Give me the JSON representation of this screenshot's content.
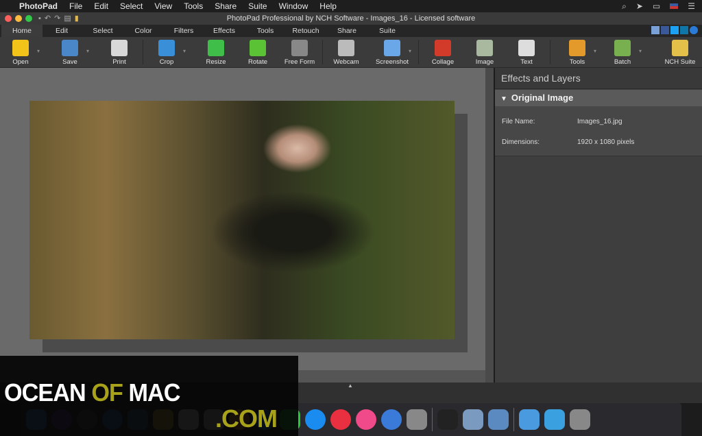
{
  "menubar": {
    "app": "PhotoPad",
    "items": [
      "File",
      "Edit",
      "Select",
      "View",
      "Tools",
      "Share",
      "Suite",
      "Window",
      "Help"
    ]
  },
  "window": {
    "title": "PhotoPad Professional by NCH Software - Images_16 - Licensed software"
  },
  "tabs": [
    "Home",
    "Edit",
    "Select",
    "Color",
    "Filters",
    "Effects",
    "Tools",
    "Retouch",
    "Share",
    "Suite"
  ],
  "active_tab": "Home",
  "toolbar": [
    {
      "label": "Open",
      "icon": "folder-icon",
      "color": "#f2c318",
      "dropdown": true
    },
    {
      "label": "Save",
      "icon": "floppy-icon",
      "color": "#4a87c9",
      "dropdown": true
    },
    {
      "label": "Print",
      "icon": "printer-icon",
      "color": "#d8d8d8"
    },
    {
      "label": "Crop",
      "icon": "crop-icon",
      "color": "#3a8fd9",
      "dropdown": true
    },
    {
      "label": "Resize",
      "icon": "resize-icon",
      "color": "#3fbf4a"
    },
    {
      "label": "Rotate",
      "icon": "rotate-icon",
      "color": "#5bc236"
    },
    {
      "label": "Free Form",
      "icon": "freeform-icon",
      "color": "#888888"
    },
    {
      "label": "Webcam",
      "icon": "webcam-icon",
      "color": "#bbbbbb"
    },
    {
      "label": "Screenshot",
      "icon": "screenshot-icon",
      "color": "#6aa7e8",
      "dropdown": true
    },
    {
      "label": "Collage",
      "icon": "collage-icon",
      "color": "#d23a2a"
    },
    {
      "label": "Image",
      "icon": "image-add-icon",
      "color": "#a9b9a0"
    },
    {
      "label": "Text",
      "icon": "text-add-icon",
      "color": "#dddddd"
    },
    {
      "label": "Tools",
      "icon": "tools-icon",
      "color": "#e39a2b",
      "dropdown": true
    },
    {
      "label": "Batch",
      "icon": "batch-icon",
      "color": "#79b04f",
      "dropdown": true
    },
    {
      "label": "NCH Suite",
      "icon": "suite-icon",
      "color": "#e3c04a"
    }
  ],
  "panel": {
    "title": "Effects and Layers",
    "section": "Original Image",
    "fields": [
      {
        "label": "File Name:",
        "value": "Images_16.jpg"
      },
      {
        "label": "Dimensions:",
        "value": "1920 x 1080 pixels"
      }
    ]
  },
  "watermark": {
    "line1a": "OCEAN",
    "line1b": "OF",
    "line1c": "MAC",
    "line2": ".COM"
  },
  "dock": [
    "finder",
    "siri",
    "launchpad",
    "safari",
    "mail",
    "notes",
    "calendar",
    "reminders",
    "photos",
    "messages",
    "facetime",
    "app-store",
    "news",
    "itunes",
    "instruments",
    "system-preferences",
    "terminal",
    "photopad",
    "preview",
    "photo-editor",
    "downloads",
    "trash"
  ],
  "dock_colors": [
    "#3a8de0",
    "#6b3fa0",
    "#555555",
    "#2a7ad0",
    "#4a6fa0",
    "#e5c040",
    "#eeeeee",
    "#cccccc",
    "#f0a030",
    "#2a8ff0",
    "#28c840",
    "#1a8cf0",
    "#e83040",
    "#f04a8a",
    "#3a7ad8",
    "#888888",
    "#222222",
    "#7a9ac0",
    "#5a8ac0",
    "#4a9ae0",
    "#3aa0e0",
    "#888888"
  ]
}
